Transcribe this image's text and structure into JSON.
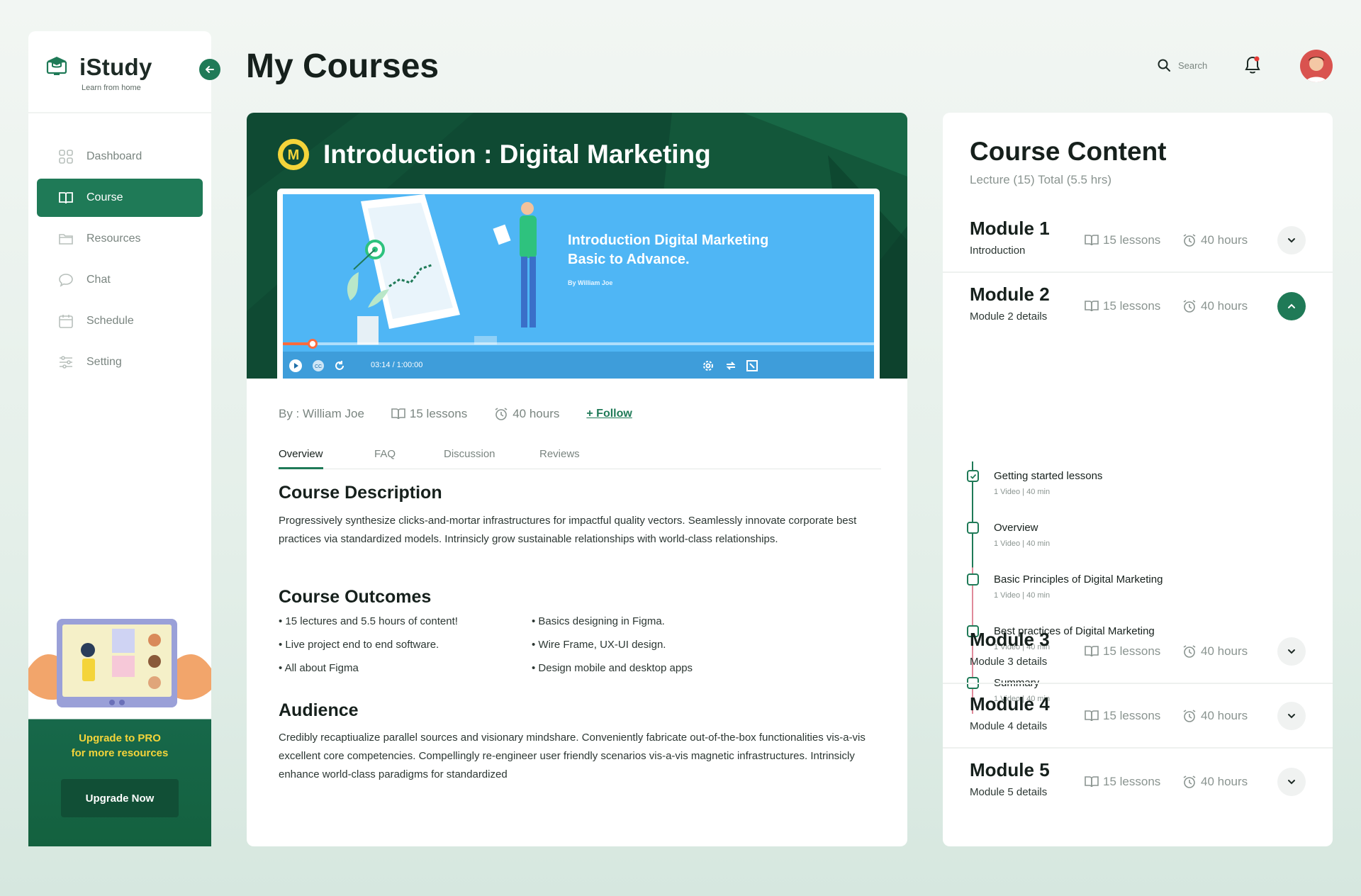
{
  "brand": {
    "name": "iStudy",
    "tagline": "Learn from home",
    "accent": "#1f7a57"
  },
  "sidebar": {
    "items": [
      {
        "label": "Dashboard",
        "icon": "grid-icon"
      },
      {
        "label": "Course",
        "icon": "book-icon",
        "active": true
      },
      {
        "label": "Resources",
        "icon": "folder-icon"
      },
      {
        "label": "Chat",
        "icon": "chat-icon"
      },
      {
        "label": "Schedule",
        "icon": "calendar-icon"
      },
      {
        "label": "Setting",
        "icon": "sliders-icon"
      }
    ],
    "promo": {
      "line1": "Upgrade to PRO",
      "line2": "for more resources",
      "button": "Upgrade Now"
    }
  },
  "header": {
    "title": "My Courses",
    "search_label": "Search"
  },
  "course": {
    "title": "Introduction : Digital Marketing",
    "video": {
      "heading_line1": "Introduction Digital Marketing",
      "heading_line2": "Basic to Advance.",
      "byline": "By William Joe",
      "time": "03:14 / 1:00:00",
      "progress": 0.05
    },
    "author": "By : William Joe",
    "lessons": "15 lessons",
    "hours": "40 hours",
    "follow": "+ Follow",
    "tabs": [
      "Overview",
      "FAQ",
      "Discussion",
      "Reviews"
    ],
    "description_title": "Course Description",
    "description": "Progressively synthesize clicks-and-mortar infrastructures for impactful quality vectors. Seamlessly innovate corporate best practices via standardized models. Intrinsicly grow sustainable relationships with world-class relationships.",
    "outcomes_title": "Course Outcomes",
    "outcomes": [
      "• 15 lectures and 5.5 hours of content!",
      "• Live project end to end software.",
      "• All about Figma",
      "• Basics designing in Figma.",
      "• Wire Frame, UX-UI design.",
      "• Design mobile and desktop apps"
    ],
    "audience_title": "Audience",
    "audience": "Credibly recaptiualize parallel sources and visionary mindshare. Conveniently fabricate out-of-the-box functionalities vis-a-vis excellent core competencies. Compellingly re-engineer user friendly scenarios vis-a-vis magnetic infrastructures. Intrinsicly enhance world-class paradigms for standardized"
  },
  "content": {
    "title": "Course Content",
    "subtitle": "Lecture (15) Total (5.5 hrs)",
    "modules": [
      {
        "title": "Module 1",
        "subtitle": "Introduction",
        "lessons": "15 lessons",
        "hours": "40 hours",
        "expanded": false
      },
      {
        "title": "Module 2",
        "subtitle": "Module 2 details",
        "lessons": "15 lessons",
        "hours": "40 hours",
        "expanded": true
      },
      {
        "title": "Module 3",
        "subtitle": "Module 3 details",
        "lessons": "15 lessons",
        "hours": "40 hours",
        "expanded": false
      },
      {
        "title": "Module 4",
        "subtitle": "Module 4 details",
        "lessons": "15 lessons",
        "hours": "40 hours",
        "expanded": false
      },
      {
        "title": "Module 5",
        "subtitle": "Module 5 details",
        "lessons": "15 lessons",
        "hours": "40 hours",
        "expanded": false
      }
    ],
    "lessons": [
      {
        "title": "Getting started lessons",
        "meta": "1 Video | 40 min",
        "done": true
      },
      {
        "title": "Overview",
        "meta": "1 Video | 40 min",
        "done": false
      },
      {
        "title": "Basic Principles of Digital Marketing",
        "meta": "1 Video | 40 min",
        "done": false
      },
      {
        "title": "Best practices of Digital Marketing",
        "meta": "1 Video | 40 min",
        "done": false
      },
      {
        "title": "Summary",
        "meta": "1 Video | 40 min",
        "done": false
      }
    ]
  }
}
